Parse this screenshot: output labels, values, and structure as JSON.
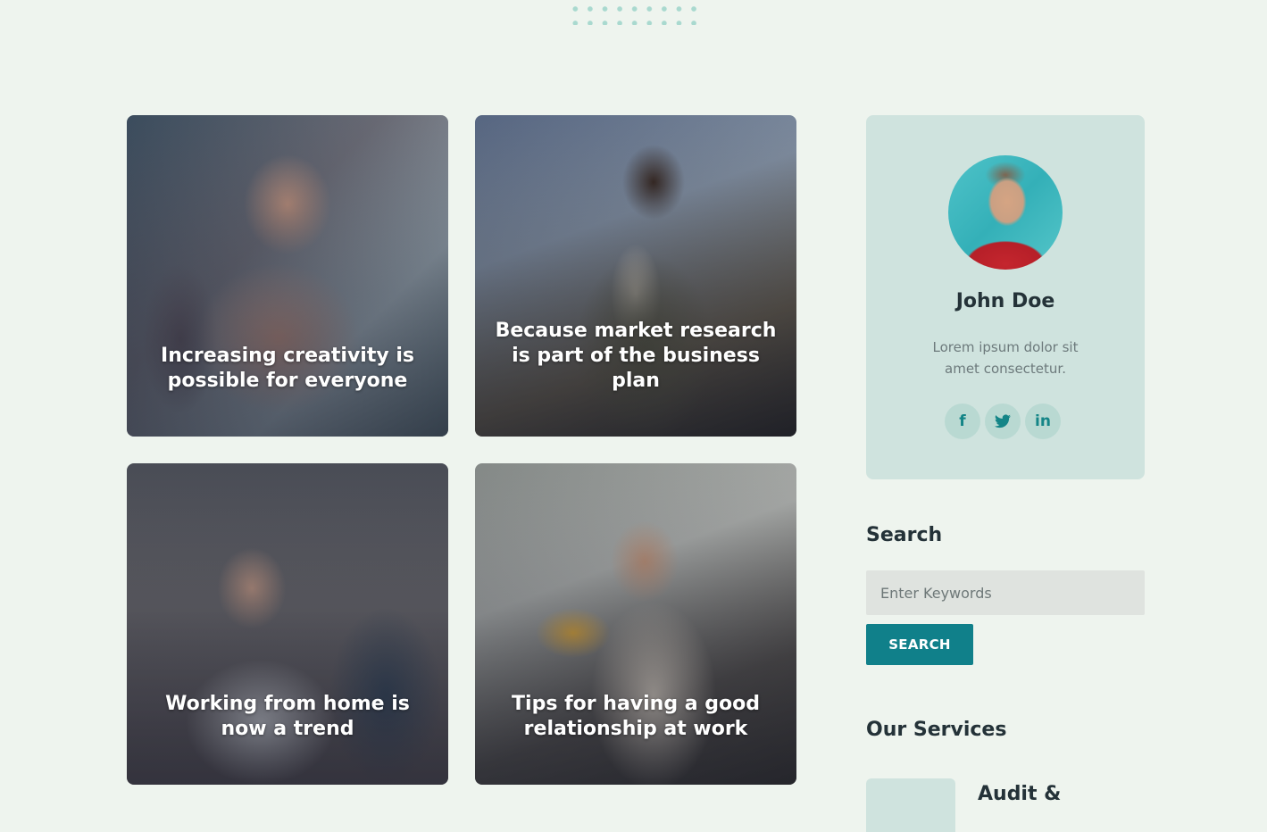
{
  "posts": [
    {
      "title": "Increasing creativity is possible for everyone"
    },
    {
      "title": "Because market research is part of the business plan"
    },
    {
      "title": "Working from home is now a trend"
    },
    {
      "title": "Tips for having a good relationship at work"
    }
  ],
  "profile": {
    "name": "John Doe",
    "bio": "Lorem ipsum dolor sit amet consectetur.",
    "social": [
      {
        "icon": "facebook-icon",
        "glyph": "f"
      },
      {
        "icon": "twitter-icon",
        "glyph": "🐦"
      },
      {
        "icon": "linkedin-icon",
        "glyph": "in"
      }
    ]
  },
  "search": {
    "heading": "Search",
    "placeholder": "Enter Keywords",
    "button_label": "SEARCH"
  },
  "services": {
    "heading": "Our Services",
    "items": [
      {
        "title": "Audit &"
      }
    ]
  },
  "colors": {
    "page_background": "#eef4ee",
    "accent": "#10808a",
    "card_tint": "#cfe3de"
  }
}
